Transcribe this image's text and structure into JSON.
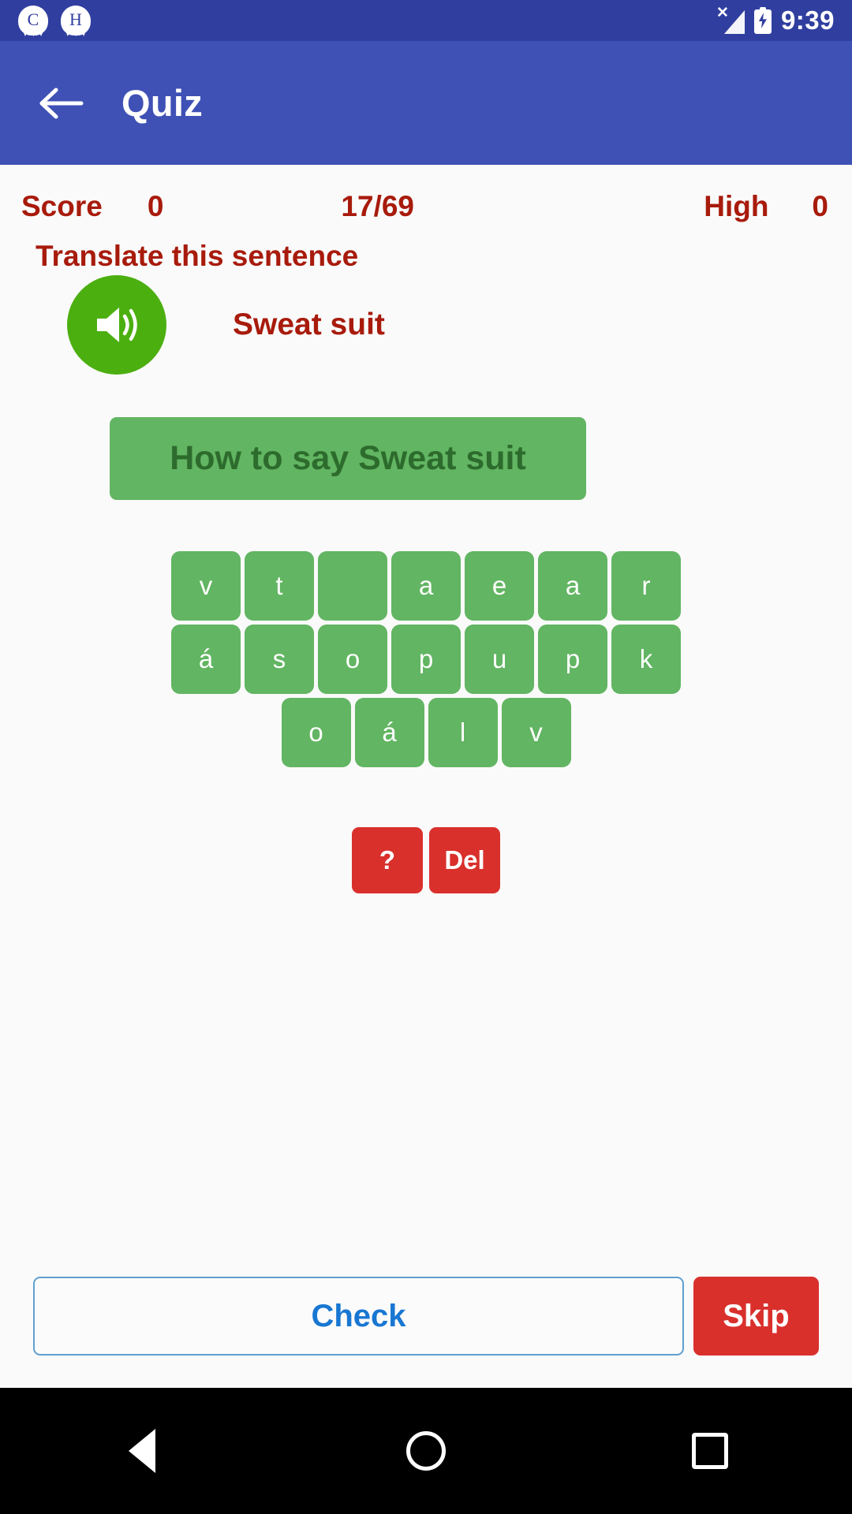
{
  "statusbar": {
    "notifications": [
      {
        "icon": "chat-notification-icon",
        "letter": "C"
      },
      {
        "icon": "chat-notification-icon",
        "letter": "H"
      }
    ],
    "signal_icon": "signal-no-service-icon",
    "battery_icon": "battery-charging-icon",
    "time": "9:39"
  },
  "appbar": {
    "back_icon": "back-arrow-icon",
    "title": "Quiz"
  },
  "stats": {
    "score_label": "Score",
    "score_value": "0",
    "progress_value": "17/69",
    "high_label": "High",
    "high_value": "0"
  },
  "quiz": {
    "instruction": "Translate this sentence",
    "speaker_icon": "speaker-volume-icon",
    "prompt_text": "Sweat suit",
    "answer_placeholder": "How to say Sweat suit",
    "tile_rows": [
      [
        "v",
        "t",
        " ",
        "a",
        "e",
        "a",
        "r"
      ],
      [
        "á",
        "s",
        "o",
        "p",
        "u",
        "p",
        "k"
      ],
      [
        "o",
        "á",
        "l",
        "v"
      ]
    ],
    "hint_label": "?",
    "delete_label": "Del"
  },
  "footer": {
    "check_label": "Check",
    "skip_label": "Skip"
  },
  "navbar": {
    "back_icon": "nav-back-icon",
    "home_icon": "nav-home-icon",
    "recents_icon": "nav-recents-icon"
  },
  "colors": {
    "status_bar": "#303f9f",
    "app_bar": "#3f51b5",
    "accent_red": "#a81b0c",
    "tile_green": "#62b562",
    "speaker_green": "#4caf10",
    "danger_red": "#d9302c",
    "link_blue": "#1877d2"
  }
}
